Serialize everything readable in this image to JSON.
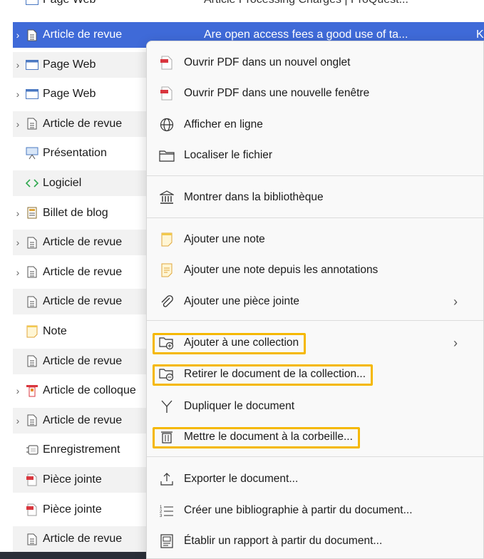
{
  "list": {
    "header_partial": {
      "type": "Page Web",
      "title": "Article Processing Charges | ProQuest..."
    },
    "rows": [
      {
        "type": "Article de revue",
        "title": "Are open access fees a good use of ta...",
        "extra": "K",
        "icon": "journal-article-icon",
        "twisty": true
      },
      {
        "type": "Page Web",
        "icon": "webpage-icon",
        "twisty": true
      },
      {
        "type": "Page Web",
        "icon": "webpage-icon",
        "twisty": true
      },
      {
        "type": "Article de revue",
        "icon": "journal-article-icon",
        "twisty": true
      },
      {
        "type": "Présentation",
        "icon": "presentation-icon",
        "twisty": false
      },
      {
        "type": "Logiciel",
        "icon": "software-icon",
        "twisty": false
      },
      {
        "type": "Billet de blog",
        "icon": "blog-post-icon",
        "twisty": true
      },
      {
        "type": "Article de revue",
        "icon": "journal-article-icon",
        "twisty": true
      },
      {
        "type": "Article de revue",
        "icon": "journal-article-icon",
        "twisty": true
      },
      {
        "type": "Article de revue",
        "icon": "journal-article-icon",
        "twisty": false
      },
      {
        "type": "Note",
        "icon": "note-icon",
        "twisty": false
      },
      {
        "type": "Article de revue",
        "icon": "journal-article-icon",
        "twisty": false
      },
      {
        "type": "Article de colloque",
        "icon": "conference-paper-icon",
        "twisty": true
      },
      {
        "type": "Article de revue",
        "icon": "journal-article-icon",
        "twisty": true
      },
      {
        "type": "Enregistrement",
        "icon": "recording-icon",
        "twisty": false
      },
      {
        "type": "Pièce jointe",
        "icon": "pdf-attachment-icon",
        "twisty": false
      },
      {
        "type": "Pièce jointe",
        "icon": "pdf-attachment-icon",
        "twisty": false
      },
      {
        "type": "Article de revue",
        "icon": "journal-article-icon",
        "twisty": false
      }
    ]
  },
  "menu": {
    "items": [
      {
        "label": "Ouvrir PDF dans un nouvel onglet",
        "icon": "pdf-icon"
      },
      {
        "label": "Ouvrir PDF dans une nouvelle fenêtre",
        "icon": "pdf-icon"
      },
      {
        "label": "Afficher en ligne",
        "icon": "globe-icon"
      },
      {
        "label": "Localiser le fichier",
        "icon": "folder-icon"
      },
      {
        "label": "Montrer dans la bibliothèque",
        "icon": "library-icon"
      },
      {
        "label": "Ajouter une note",
        "icon": "note-icon"
      },
      {
        "label": "Ajouter une note depuis les annotations",
        "icon": "annotation-note-icon"
      },
      {
        "label": "Ajouter une pièce jointe",
        "icon": "paperclip-icon",
        "submenu": true
      },
      {
        "label": "Ajouter à une collection",
        "icon": "collection-add-icon",
        "submenu": true,
        "highlighted": true
      },
      {
        "label": "Retirer le document de la collection...",
        "icon": "collection-remove-icon",
        "highlighted": true
      },
      {
        "label": "Dupliquer le document",
        "icon": "duplicate-icon"
      },
      {
        "label": "Mettre le document à la corbeille...",
        "icon": "trash-icon",
        "highlighted": true
      },
      {
        "label": "Exporter le document...",
        "icon": "export-icon"
      },
      {
        "label": "Créer une bibliographie à partir du document...",
        "icon": "bibliography-icon"
      },
      {
        "label": "Établir un rapport à partir du document...",
        "icon": "report-icon"
      }
    ]
  },
  "colors": {
    "selection": "#3f6ad8",
    "highlight_box": "#f5b800",
    "pdf_red": "#d9363e",
    "note_yellow": "#f2c94c"
  }
}
